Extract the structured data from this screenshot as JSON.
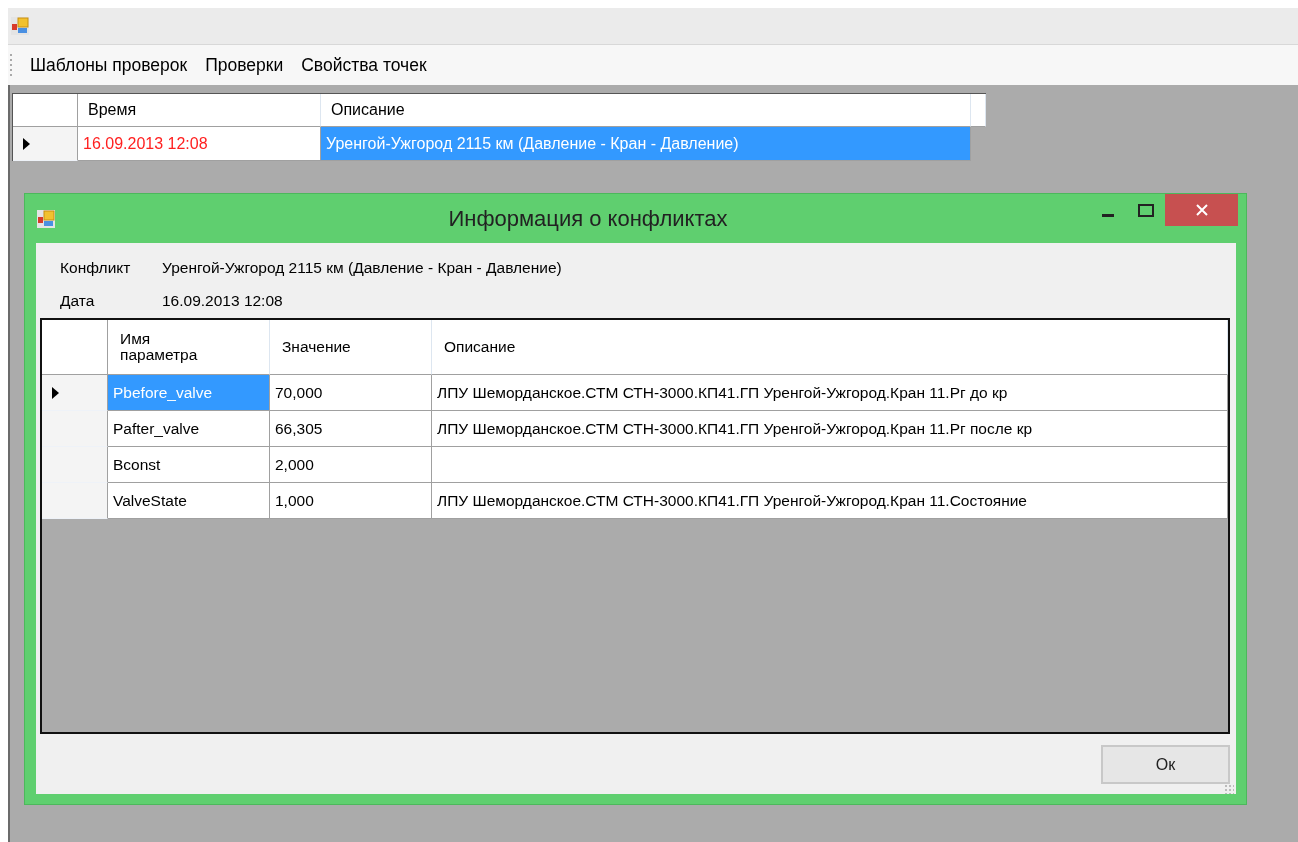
{
  "menu": [
    {
      "label": "Шаблоны проверок"
    },
    {
      "label": "Проверки"
    },
    {
      "label": "Свойства точек"
    }
  ],
  "main_grid": {
    "columns": [
      "Время",
      "Описание"
    ],
    "rows": [
      {
        "current": true,
        "cells": [
          {
            "text": "16.09.2013 12:08",
            "selected": false
          },
          {
            "text": "Уренгой-Ужгород 2115 км (Давление - Кран - Давление)",
            "selected": true
          }
        ]
      }
    ]
  },
  "dialog": {
    "title": "Информация о конфликтах",
    "fields": [
      {
        "label": "Конфликт",
        "value": "Уренгой-Ужгород 2115 км (Давление - Кран - Давление)"
      },
      {
        "label": "Дата",
        "value": "16.09.2013 12:08"
      }
    ],
    "grid": {
      "columns": [
        "Имя параметра",
        "Значение",
        "Описание"
      ],
      "rows": [
        {
          "current": true,
          "cells": [
            {
              "text": "Pbefore_valve",
              "selected": true
            },
            {
              "text": "70,000",
              "selected": false
            },
            {
              "text": "ЛПУ Шеморданское.СТМ СТН-3000.КП41.ГП Уренгой-Ужгород.Кран 11.Рг до кр",
              "selected": false
            }
          ]
        },
        {
          "current": false,
          "cells": [
            {
              "text": "Pafter_valve",
              "selected": false
            },
            {
              "text": "66,305",
              "selected": false
            },
            {
              "text": "ЛПУ Шеморданское.СТМ СТН-3000.КП41.ГП Уренгой-Ужгород.Кран 11.Рг после кр",
              "selected": false
            }
          ]
        },
        {
          "current": false,
          "cells": [
            {
              "text": "Bconst",
              "selected": false
            },
            {
              "text": "2,000",
              "selected": false
            },
            {
              "text": "",
              "selected": false
            }
          ]
        },
        {
          "current": false,
          "cells": [
            {
              "text": "ValveState",
              "selected": false
            },
            {
              "text": "1,000",
              "selected": false
            },
            {
              "text": "ЛПУ Шеморданское.СТМ СТН-3000.КП41.ГП Уренгой-Ужгород.Кран 11.Состояние",
              "selected": false
            }
          ]
        }
      ]
    },
    "ok_button": "Ок"
  }
}
